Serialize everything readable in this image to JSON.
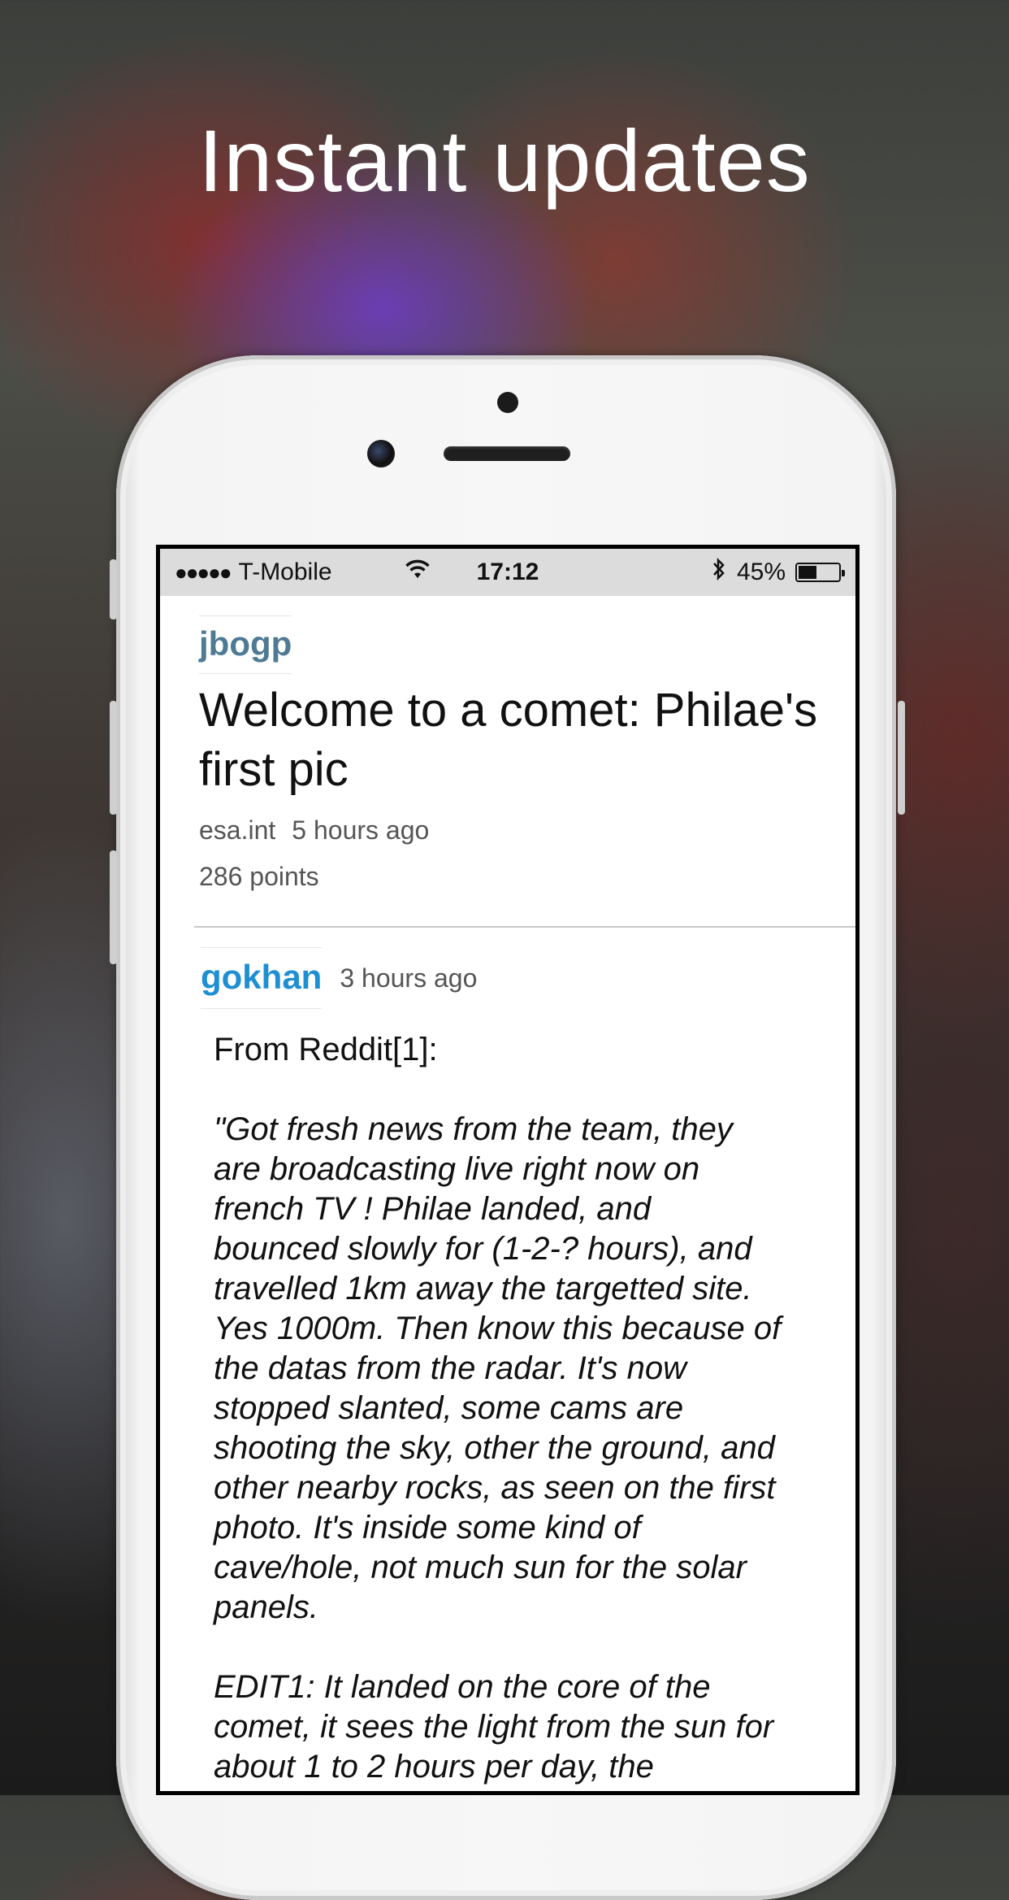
{
  "headline": "Instant updates",
  "status_bar": {
    "carrier": "T-Mobile",
    "signal_dots": "●●●●●",
    "time": "17:12",
    "battery_percent": "45%",
    "battery_level": 0.45,
    "icons": [
      "wifi-icon",
      "bluetooth-icon",
      "battery-icon"
    ]
  },
  "story": {
    "author": "jbogp",
    "title": "Welcome to a comet: Philae's first pic",
    "domain": "esa.int",
    "time": "5 hours ago",
    "points": "286 points"
  },
  "comment": {
    "author": "gokhan",
    "time": "3 hours ago",
    "intro": "From Reddit[1]:",
    "quote": "\"Got fresh news from the team, they are broadcasting live right now on french TV ! Philae landed, and bounced slowly for (1-2-? hours), and travelled 1km away the targetted site. Yes 1000m. Then know this because of the datas from the radar. It's now stopped slanted, some cams are shooting the sky, other the ground, and other nearby rocks, as seen on the first photo. It's inside some kind of cave/hole, not much sun for the solar panels.",
    "edit": "EDIT1: It landed on the core of the comet, it sees the light from the sun for about 1 to 2 hours per day, the"
  },
  "colors": {
    "story_author": "#4e7a94",
    "comment_author": "#1e8fd3",
    "status_bar_bg": "#dcdcdc"
  }
}
